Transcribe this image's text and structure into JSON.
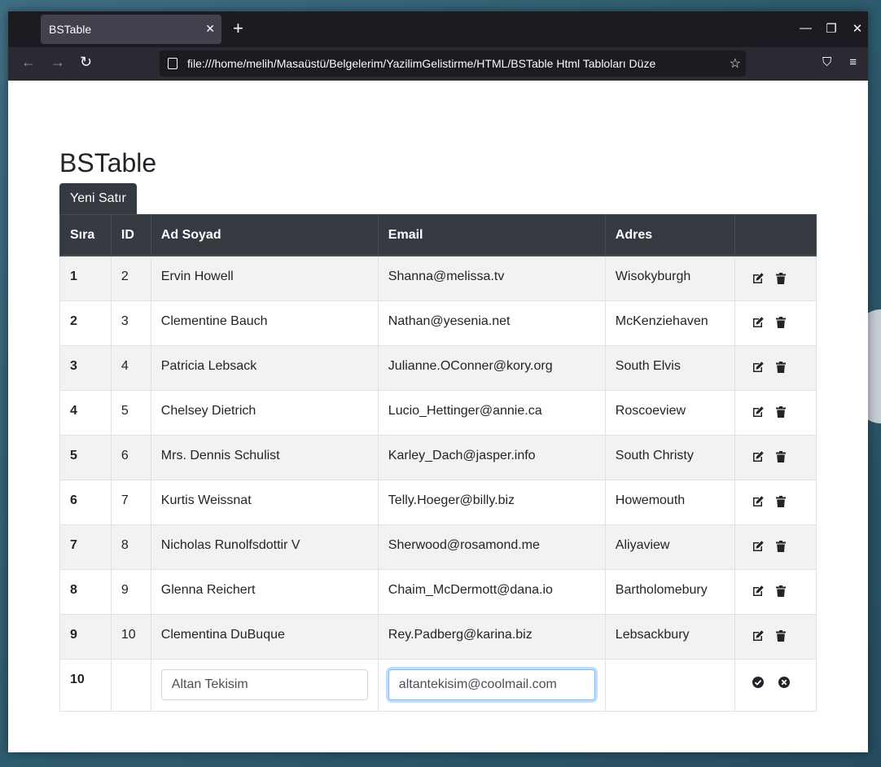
{
  "browser": {
    "tab_title": "BSTable",
    "url": "file:///home/melih/Masaüstü/Belgelerim/YazilimGelistirme/HTML/BSTable Html Tabloları Düze"
  },
  "page": {
    "title": "BSTable",
    "new_row_button": "Yeni Satır"
  },
  "table": {
    "headers": [
      "Sıra",
      "ID",
      "Ad Soyad",
      "Email",
      "Adres",
      ""
    ],
    "rows": [
      {
        "sira": "1",
        "id": "2",
        "name": "Ervin Howell",
        "email": "Shanna@melissa.tv",
        "address": "Wisokyburgh"
      },
      {
        "sira": "2",
        "id": "3",
        "name": "Clementine Bauch",
        "email": "Nathan@yesenia.net",
        "address": "McKenziehaven"
      },
      {
        "sira": "3",
        "id": "4",
        "name": "Patricia Lebsack",
        "email": "Julianne.OConner@kory.org",
        "address": "South Elvis"
      },
      {
        "sira": "4",
        "id": "5",
        "name": "Chelsey Dietrich",
        "email": "Lucio_Hettinger@annie.ca",
        "address": "Roscoeview"
      },
      {
        "sira": "5",
        "id": "6",
        "name": "Mrs. Dennis Schulist",
        "email": "Karley_Dach@jasper.info",
        "address": "South Christy"
      },
      {
        "sira": "6",
        "id": "7",
        "name": "Kurtis Weissnat",
        "email": "Telly.Hoeger@billy.biz",
        "address": "Howemouth"
      },
      {
        "sira": "7",
        "id": "8",
        "name": "Nicholas Runolfsdottir V",
        "email": "Sherwood@rosamond.me",
        "address": "Aliyaview"
      },
      {
        "sira": "8",
        "id": "9",
        "name": "Glenna Reichert",
        "email": "Chaim_McDermott@dana.io",
        "address": "Bartholomebury"
      },
      {
        "sira": "9",
        "id": "10",
        "name": "Clementina DuBuque",
        "email": "Rey.Padberg@karina.biz",
        "address": "Lebsackbury"
      }
    ],
    "edit_row": {
      "sira": "10",
      "name_value": "Altan Tekisim",
      "email_value": "altantekisim@coolmail.com"
    }
  }
}
